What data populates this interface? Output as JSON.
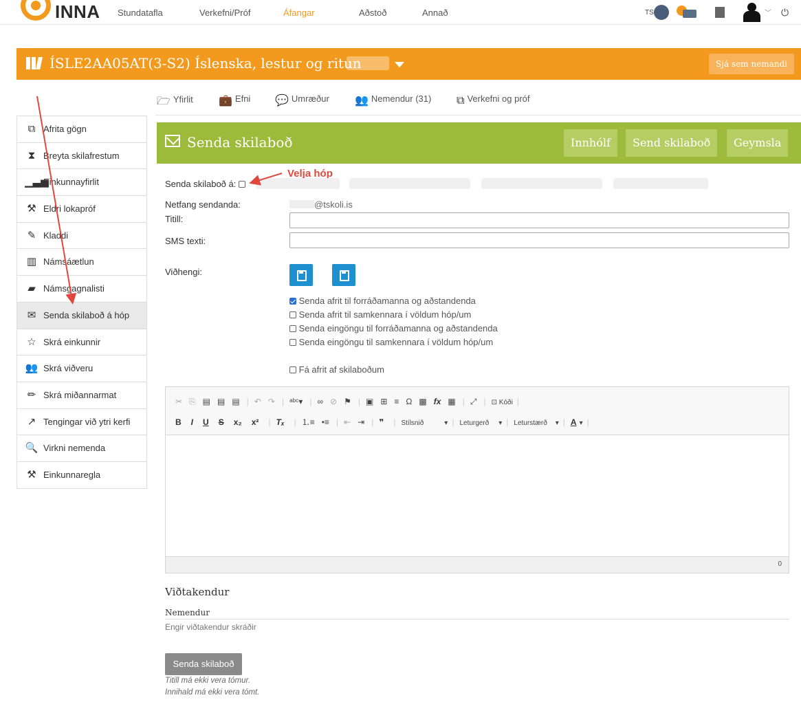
{
  "top_nav": {
    "brand": "INNA",
    "links": [
      "Stundatafla",
      "Verkefni/Próf",
      "Áfangar",
      "Aðstoð",
      "Annað"
    ],
    "active_link": "Áfangar",
    "user_initials": "TS"
  },
  "banner": {
    "course_title": "ÍSLE2AA05AT(3-S2) Íslenska, lestur og ritun",
    "view_as_student": "Sjá sem nemandi"
  },
  "tabs": [
    {
      "label": "Yfirlit",
      "icon": "folder-icon"
    },
    {
      "label": "Efni",
      "icon": "briefcase-icon"
    },
    {
      "label": "Umræður",
      "icon": "comments-icon"
    },
    {
      "label": "Nemendur (31)",
      "icon": "users-icon"
    },
    {
      "label": "Verkefni og próf",
      "icon": "copy-icon"
    }
  ],
  "sidebar": {
    "items": [
      {
        "label": "Afrita gögn",
        "icon": "copy-icon"
      },
      {
        "label": "Breyta skilafrestum",
        "icon": "hourglass-icon"
      },
      {
        "label": "Einkunnayfirlit",
        "icon": "bar-chart-icon"
      },
      {
        "label": "Eldri lokapróf",
        "icon": "gavel-icon"
      },
      {
        "label": "Kladdi",
        "icon": "edit-icon"
      },
      {
        "label": "Námsáætlun",
        "icon": "map-icon"
      },
      {
        "label": "Námsgagnalisti",
        "icon": "book-icon"
      },
      {
        "label": "Senda skilaboð á hóp",
        "icon": "envelope-icon",
        "active": true
      },
      {
        "label": "Skrá einkunnir",
        "icon": "star-icon"
      },
      {
        "label": "Skrá viðveru",
        "icon": "users-icon"
      },
      {
        "label": "Skrá miðannarmat",
        "icon": "pencil-icon"
      },
      {
        "label": "Tengingar við ytri kerfi",
        "icon": "external-link-icon"
      },
      {
        "label": "Virkni nemenda",
        "icon": "search-icon"
      },
      {
        "label": "Einkunnaregla",
        "icon": "gavel-icon"
      }
    ]
  },
  "panel": {
    "title": "Senda skilaboð",
    "buttons": [
      "Innhólf",
      "Send skilaboð",
      "Geymsla"
    ]
  },
  "form": {
    "send_to_label": "Senda skilaboð á:",
    "annotation": "Velja hóp",
    "sender_label": "Netfang sendanda:",
    "sender_email": "@tskoli.is",
    "title_label": "Titill:",
    "title_value": "",
    "sms_label": "SMS texti:",
    "sms_value": "",
    "attachments_label": "Viðhengi:",
    "checkboxes": [
      {
        "label": "Senda afrit til forráðamanna og aðstandenda",
        "checked": true
      },
      {
        "label": "Senda afrit til samkennara í völdum hóp/um",
        "checked": false
      },
      {
        "label": "Senda eingöngu til forráðamanna og aðstandenda",
        "checked": false
      },
      {
        "label": "Senda eingöngu til samkennara í völdum hóp/um",
        "checked": false
      }
    ],
    "copy_to_self": "Fá afrit af skilaboðum"
  },
  "editor": {
    "source_label": "Kóði",
    "style_label": "Stílsnið",
    "font_label": "Leturgerð",
    "size_label": "Leturstærð",
    "char_count": "0"
  },
  "recipients": {
    "title": "Viðtakendur",
    "students_label": "Nemendur",
    "none_text": "Engir viðtakendur skráðir"
  },
  "submit": {
    "label": "Senda skilaboð",
    "error_title": "Titill má ekki vera tómur.",
    "error_body": "Innihald má ekki vera tómt."
  },
  "colors": {
    "accent_orange": "#f39a1e",
    "panel_green": "#9dbb3a",
    "annotation_red": "#e0483d"
  }
}
